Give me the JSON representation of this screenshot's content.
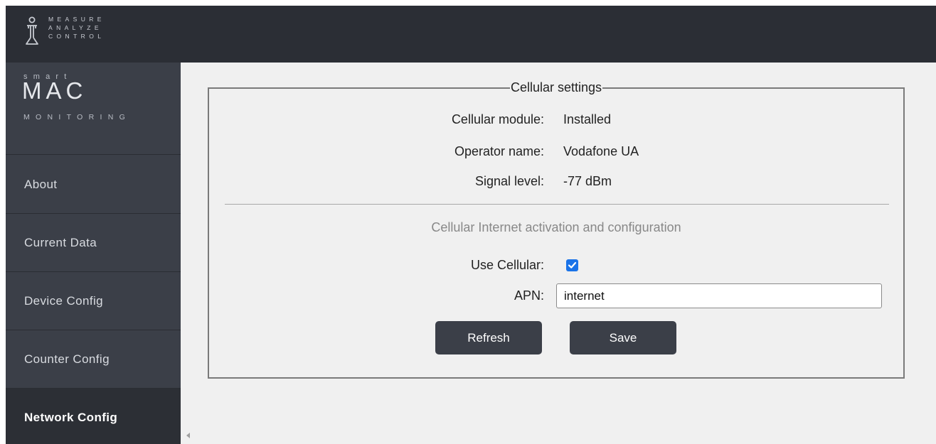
{
  "branding": {
    "logo_lines": [
      "MEASURE",
      "ANALYZE",
      "CONTROL"
    ],
    "brand_top": "smart",
    "brand_main": "MAC",
    "brand_sub": "MONITORING"
  },
  "nav": {
    "items": [
      {
        "label": "About",
        "active": false
      },
      {
        "label": "Current Data",
        "active": false
      },
      {
        "label": "Device Config",
        "active": false
      },
      {
        "label": "Counter Config",
        "active": false
      },
      {
        "label": "Network Config",
        "active": true
      }
    ]
  },
  "cellular": {
    "legend": "Cellular settings",
    "module_label": "Cellular module:",
    "module_value": "Installed",
    "operator_label": "Operator name:",
    "operator_value": "Vodafone UA",
    "signal_label": "Signal level:",
    "signal_value": "-77 dBm",
    "config_heading": "Cellular Internet activation and configuration",
    "use_cellular_label": "Use Cellular:",
    "use_cellular_checked": true,
    "apn_label": "APN:",
    "apn_value": "internet",
    "refresh_label": "Refresh",
    "save_label": "Save"
  },
  "colors": {
    "topbar": "#2b2e35",
    "sidebar": "#3b3f48",
    "active_nav": "#2c2f35",
    "content_bg": "#f0f0f0",
    "checkbox_accent": "#1a73e8"
  }
}
